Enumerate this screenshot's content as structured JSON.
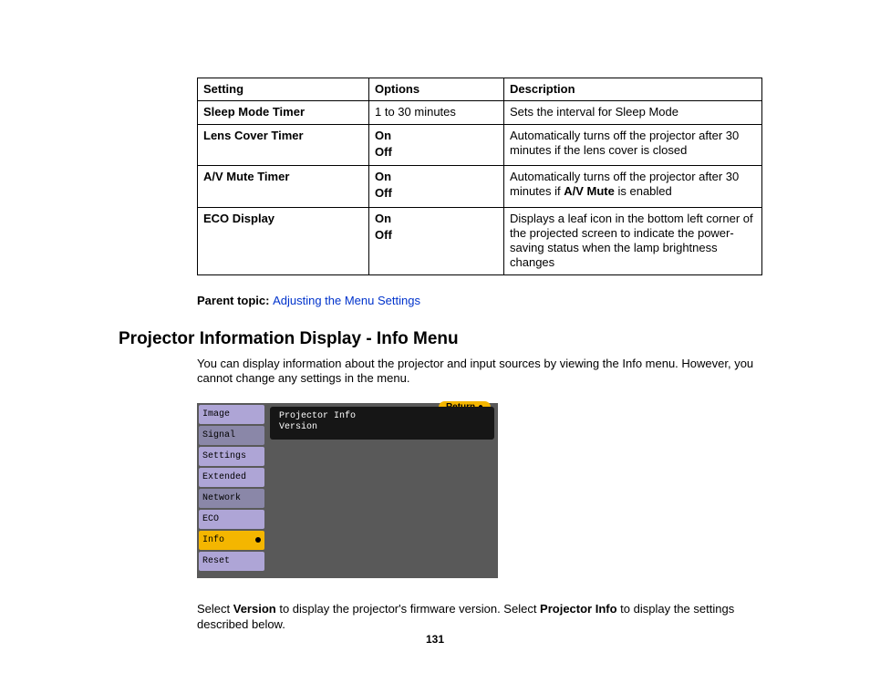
{
  "table": {
    "headers": [
      "Setting",
      "Options",
      "Description"
    ],
    "rows": [
      {
        "setting": "Sleep Mode Timer",
        "options_plain": "1 to 30 minutes",
        "desc": "Sets the interval for Sleep Mode"
      },
      {
        "setting": "Lens Cover Timer",
        "options_a": "On",
        "options_b": "Off",
        "desc": "Automatically turns off the projector after 30 minutes if the lens cover is closed"
      },
      {
        "setting": "A/V Mute Timer",
        "options_a": "On",
        "options_b": "Off",
        "desc_pre": "Automatically turns off the projector after 30 minutes if ",
        "desc_bold": "A/V Mute",
        "desc_post": " is enabled"
      },
      {
        "setting": "ECO Display",
        "options_a": "On",
        "options_b": "Off",
        "desc": "Displays a leaf icon in the bottom left corner of the projected screen to indicate the power-saving status when the lamp brightness changes"
      }
    ]
  },
  "parent_topic": {
    "label": "Parent topic: ",
    "link": "Adjusting the Menu Settings"
  },
  "section_title": "Projector Information Display - Info Menu",
  "intro_text": "You can display information about the projector and input sources by viewing the Info menu. However, you cannot change any settings in the menu.",
  "menu": {
    "items": [
      "Image",
      "Signal",
      "Settings",
      "Extended",
      "Network",
      "ECO",
      "Info",
      "Reset"
    ],
    "return_label": "Return",
    "line1": "Projector Info",
    "line2": "Version"
  },
  "footer_text": {
    "pre": "Select ",
    "b1": "Version",
    "mid": " to display the projector's firmware version. Select ",
    "b2": "Projector Info",
    "post": " to display the settings described below."
  },
  "page_number": "131"
}
